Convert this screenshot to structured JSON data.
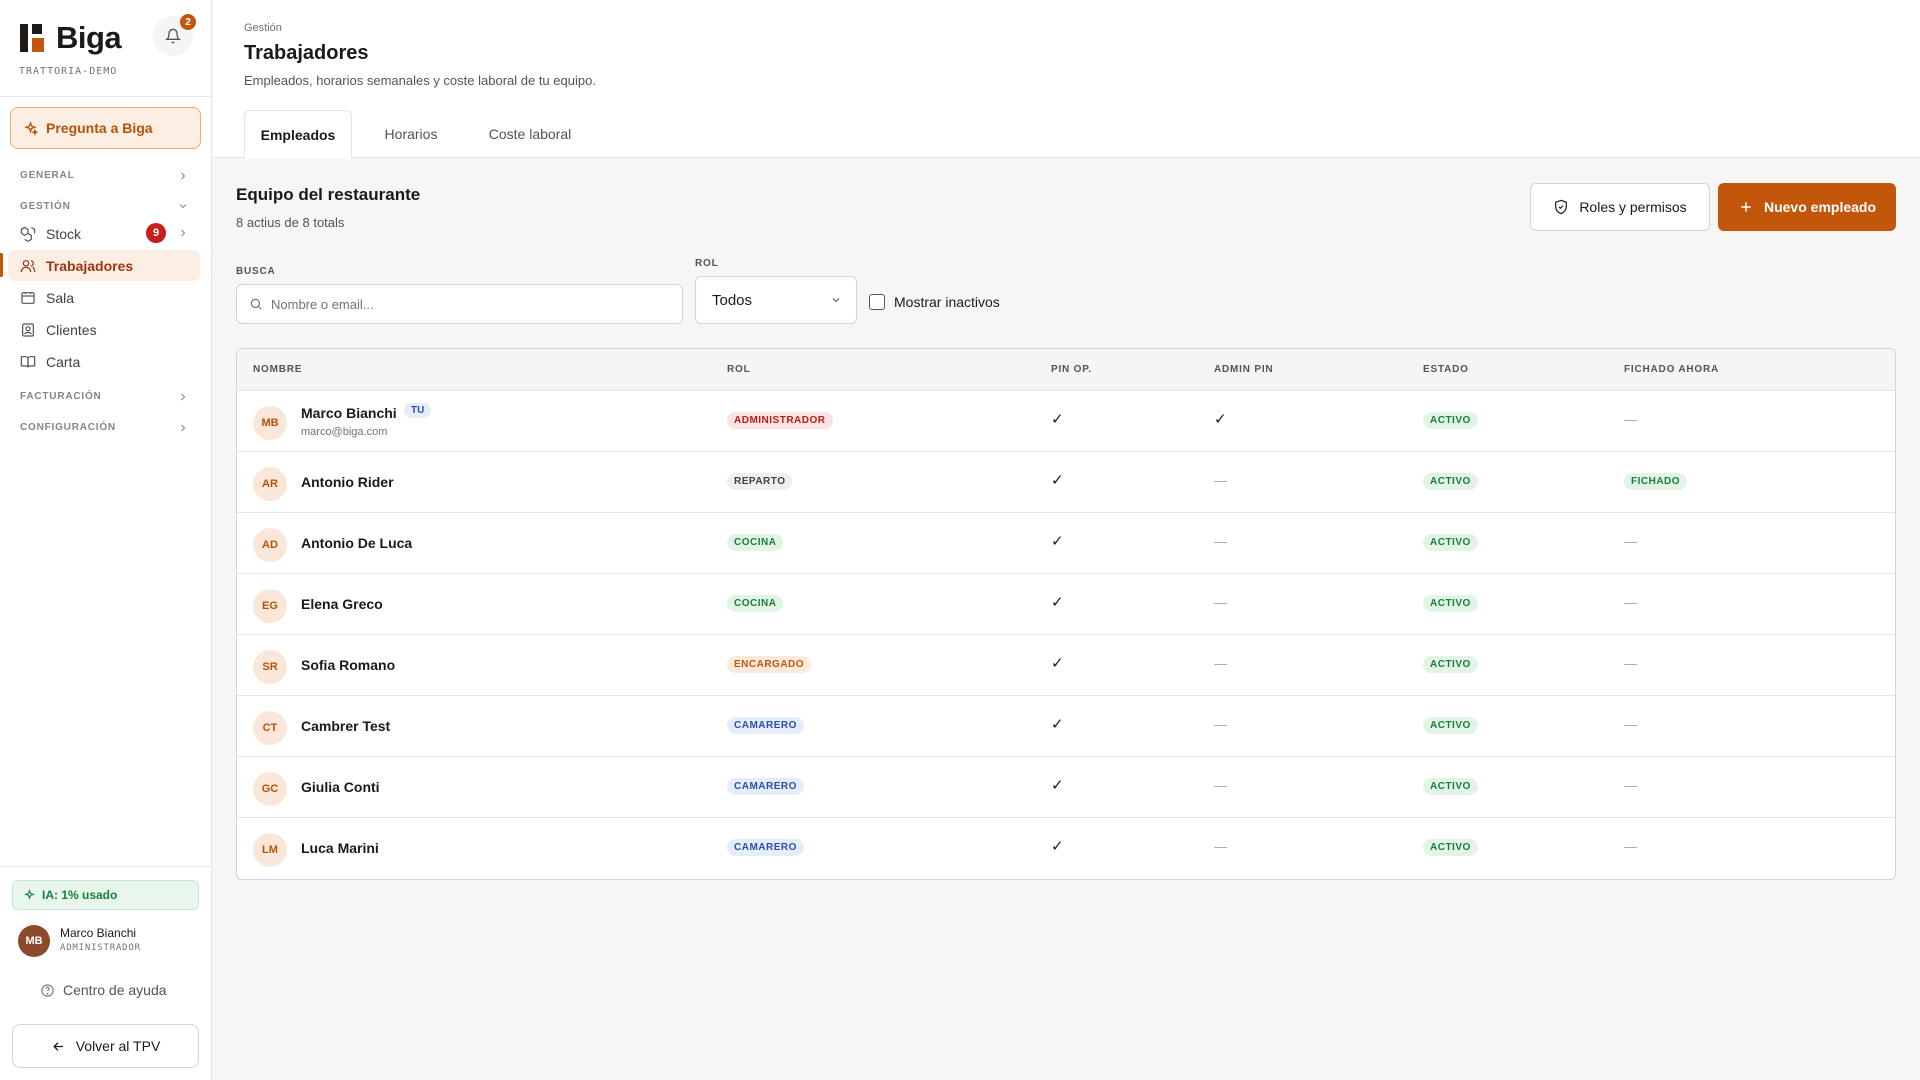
{
  "brand": {
    "name": "Biga",
    "tenant": "TRATTORIA-DEMO",
    "notifications": "2"
  },
  "sidebar": {
    "ask_label": "Pregunta a Biga",
    "sections": {
      "general": "GENERAL",
      "gestion": "GESTIÓN",
      "facturacion": "FACTURACIÓN",
      "configuracion": "CONFIGURACIÓN"
    },
    "items": [
      {
        "label": "Stock",
        "badge": "9",
        "icon": "boxes-icon"
      },
      {
        "label": "Trabajadores",
        "icon": "users-icon",
        "active": true
      },
      {
        "label": "Sala",
        "icon": "table-icon"
      },
      {
        "label": "Clientes",
        "icon": "contact-icon"
      },
      {
        "label": "Carta",
        "icon": "book-icon"
      }
    ],
    "ia_usage": "IA: 1% usado",
    "user": {
      "initials": "MB",
      "name": "Marco Bianchi",
      "role": "ADMINISTRADOR"
    },
    "help": "Centro de ayuda",
    "back": "Volver al TPV"
  },
  "header": {
    "breadcrumb": "Gestión",
    "title": "Trabajadores",
    "subtitle": "Empleados, horarios semanales y coste laboral de tu equipo.",
    "tabs": [
      "Empleados",
      "Horarios",
      "Coste laboral"
    ]
  },
  "section": {
    "title": "Equipo del restaurante",
    "subtitle": "8 actius de 8 totals",
    "roles_button": "Roles y permisos",
    "new_button": "Nuevo empleado"
  },
  "filters": {
    "search_label": "BUSCA",
    "search_placeholder": "Nombre o email...",
    "role_label": "ROL",
    "role_value": "Todos",
    "show_inactive": "Mostrar inactivos"
  },
  "table": {
    "columns": [
      "NOMBRE",
      "ROL",
      "PIN OP.",
      "ADMIN PIN",
      "ESTADO",
      "FICHADO AHORA"
    ],
    "rows": [
      {
        "initials": "MB",
        "name": "Marco Bianchi",
        "you": "TU",
        "email": "marco@biga.com",
        "role": "ADMINISTRADOR",
        "pin_op": "✓",
        "admin_pin": "✓",
        "status": "ACTIVO",
        "clocked": "—"
      },
      {
        "initials": "AR",
        "name": "Antonio Rider",
        "role": "REPARTO",
        "pin_op": "✓",
        "admin_pin": "—",
        "status": "ACTIVO",
        "clocked": "FICHADO"
      },
      {
        "initials": "AD",
        "name": "Antonio De Luca",
        "role": "COCINA",
        "pin_op": "✓",
        "admin_pin": "—",
        "status": "ACTIVO",
        "clocked": "—"
      },
      {
        "initials": "EG",
        "name": "Elena Greco",
        "role": "COCINA",
        "pin_op": "✓",
        "admin_pin": "—",
        "status": "ACTIVO",
        "clocked": "—"
      },
      {
        "initials": "SR",
        "name": "Sofia Romano",
        "role": "ENCARGADO",
        "pin_op": "✓",
        "admin_pin": "—",
        "status": "ACTIVO",
        "clocked": "—"
      },
      {
        "initials": "CT",
        "name": "Cambrer Test",
        "role": "CAMARERO",
        "pin_op": "✓",
        "admin_pin": "—",
        "status": "ACTIVO",
        "clocked": "—"
      },
      {
        "initials": "GC",
        "name": "Giulia Conti",
        "role": "CAMARERO",
        "pin_op": "✓",
        "admin_pin": "—",
        "status": "ACTIVO",
        "clocked": "—"
      },
      {
        "initials": "LM",
        "name": "Luca Marini",
        "role": "CAMARERO",
        "pin_op": "✓",
        "admin_pin": "—",
        "status": "ACTIVO",
        "clocked": "—"
      }
    ]
  },
  "colors": {
    "accent": "#c2570c",
    "role_admin_bg": "#fde4e4",
    "role_admin_fg": "#b91c1c",
    "role_reparto_bg": "#f0efed",
    "role_reparto_fg": "#44403c",
    "role_cocina_bg": "#e3f4e7",
    "role_cocina_fg": "#15803d",
    "role_encargado_bg": "#fdeadb",
    "role_encargado_fg": "#c2570c",
    "role_camarero_bg": "#e5edfb",
    "role_camarero_fg": "#2b4fa8",
    "status_bg": "#e3f4e7",
    "status_fg": "#15803d"
  }
}
